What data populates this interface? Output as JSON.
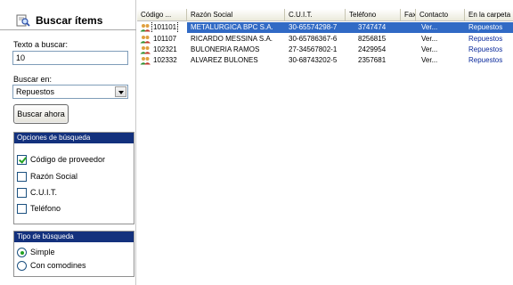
{
  "search_panel": {
    "title": "Buscar ítems",
    "text_label": "Texto a buscar:",
    "text_value": "10",
    "search_in_label": "Buscar en:",
    "search_in_value": "Repuestos",
    "search_button": "Buscar ahora",
    "options_title": "Opciones de búsqueda",
    "options": [
      {
        "label": "Código de proveedor",
        "checked": true
      },
      {
        "label": "Razón Social",
        "checked": false
      },
      {
        "label": "C.U.I.T.",
        "checked": false
      },
      {
        "label": "Teléfono",
        "checked": false
      }
    ],
    "type_title": "Tipo de búsqueda",
    "types": [
      {
        "label": "Simple",
        "selected": true
      },
      {
        "label": "Con comodines",
        "selected": false
      }
    ]
  },
  "grid": {
    "columns": [
      "Código ...",
      "Razón Social",
      "C.U.I.T.",
      "Teléfono",
      "Fax",
      "Contacto",
      "En la carpeta"
    ],
    "rows": [
      {
        "code": "101101",
        "razon": "METALURGICA BPC S.A.",
        "cuit": "30-65574298-7",
        "telefono": "3747474",
        "fax": "",
        "contacto": "Ver...",
        "carpeta": "Repuestos",
        "selected": true
      },
      {
        "code": "101107",
        "razon": "RICARDO MESSINA S.A.",
        "cuit": "30-65786367-6",
        "telefono": "8256815",
        "fax": "",
        "contacto": "Ver...",
        "carpeta": "Repuestos",
        "selected": false
      },
      {
        "code": "102321",
        "razon": "BULONERIA RAMOS",
        "cuit": "27-34567802-1",
        "telefono": "2429954",
        "fax": "",
        "contacto": "Ver...",
        "carpeta": "Repuestos",
        "selected": false
      },
      {
        "code": "102332",
        "razon": "ALVAREZ BULONES",
        "cuit": "30-68743202-5",
        "telefono": "2357681",
        "fax": "",
        "contacto": "Ver...",
        "carpeta": "Repuestos",
        "selected": false
      }
    ]
  },
  "colors": {
    "selection": "#316ac5",
    "group_header": "#13317d",
    "folder_link": "#0b2a9c"
  }
}
